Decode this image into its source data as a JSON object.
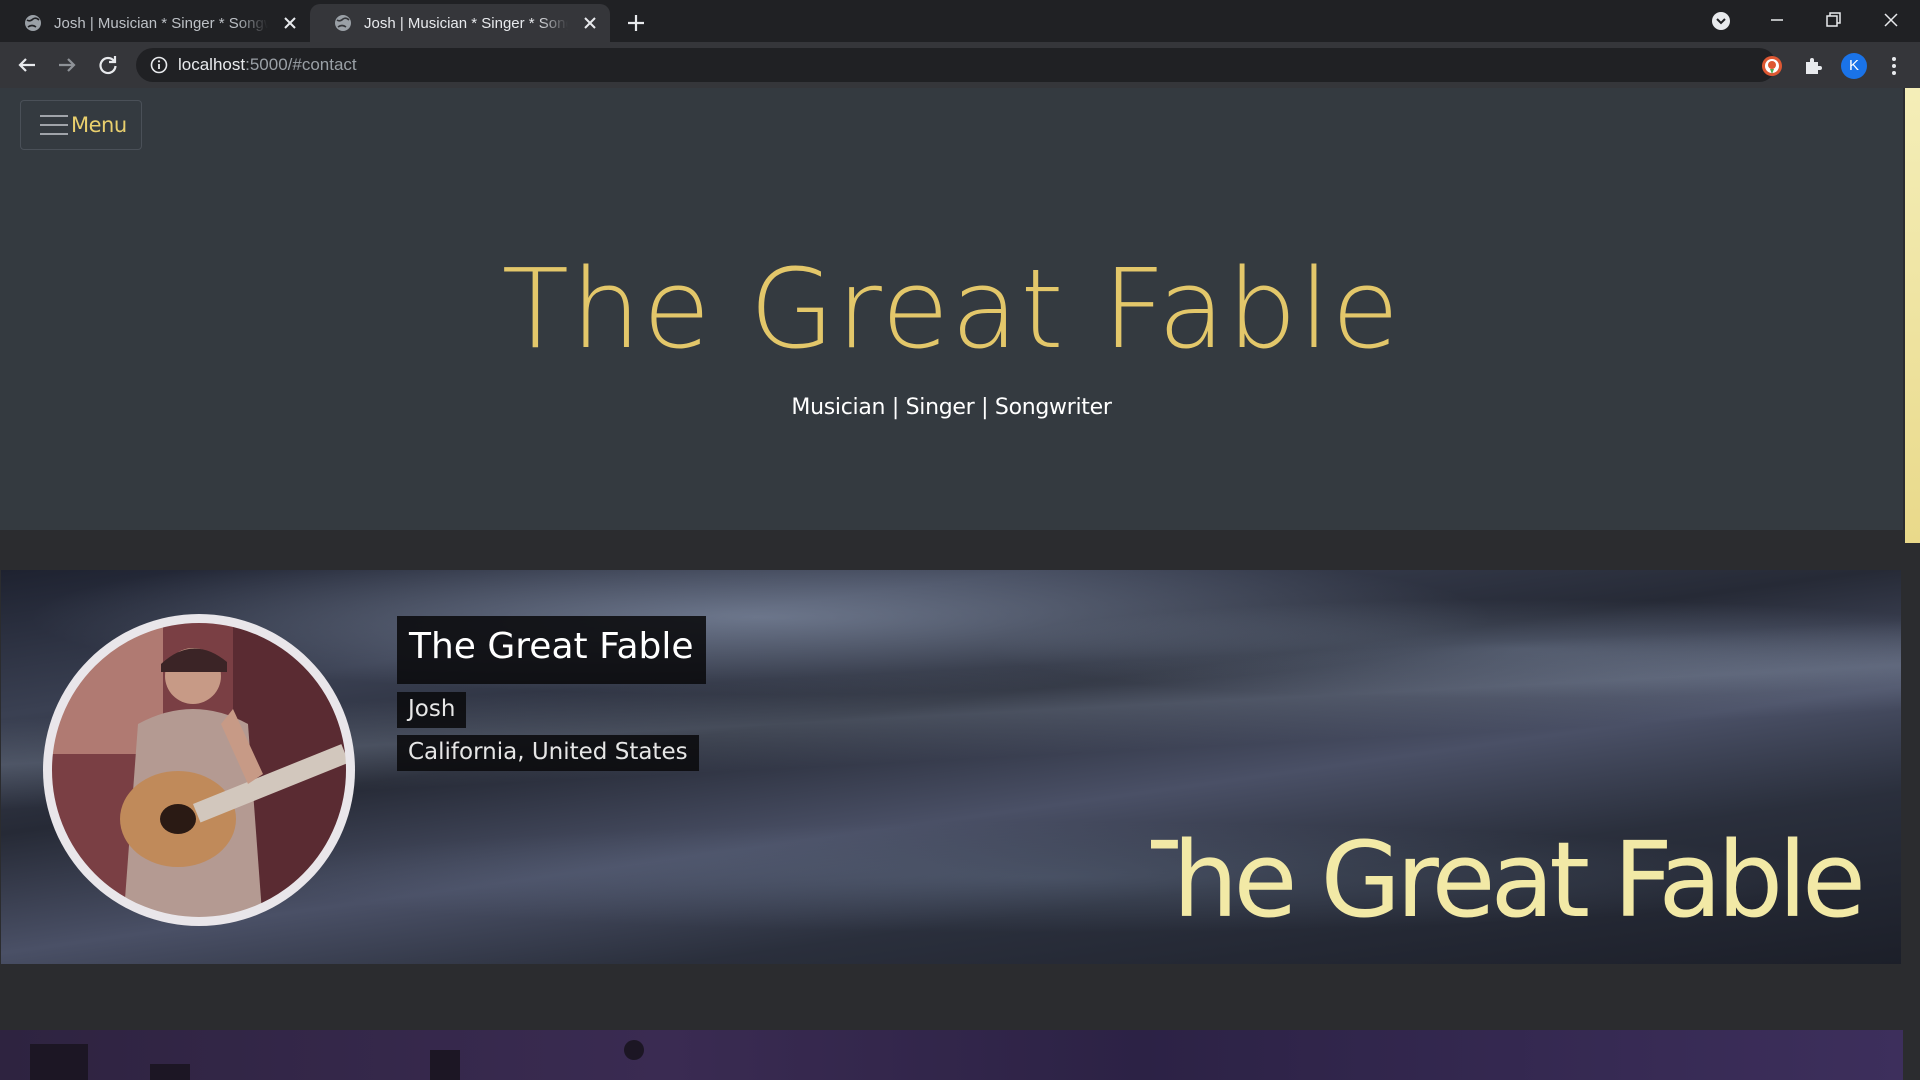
{
  "browser": {
    "tabs": [
      {
        "title": "Josh | Musician * Singer * Songwriter",
        "active": false
      },
      {
        "title": "Josh | Musician * Singer * Songwriter",
        "active": true
      }
    ],
    "address": {
      "host": "localhost",
      "path": ":5000/#contact"
    },
    "profile_initial": "K"
  },
  "page": {
    "menu_label": "Menu",
    "title": "The Great Fable",
    "subtitle": "Musician | Singer | Songwriter",
    "profile": {
      "artist": "The Great Fable",
      "person": "Josh",
      "location": "California, United States"
    },
    "banner_logo_text": "The Great Fable"
  },
  "colors": {
    "accent_gold": "#e3c76a",
    "header_bg": "#343a40",
    "page_bg": "#2b2c2f"
  },
  "icons": [
    "globe-icon",
    "close-icon",
    "plus-icon",
    "tab-search-icon",
    "minimize-icon",
    "restore-icon",
    "back-icon",
    "forward-icon",
    "reload-icon",
    "info-icon",
    "star-icon",
    "extension-icon",
    "puzzle-icon",
    "kebab-menu-icon",
    "hamburger-icon"
  ]
}
